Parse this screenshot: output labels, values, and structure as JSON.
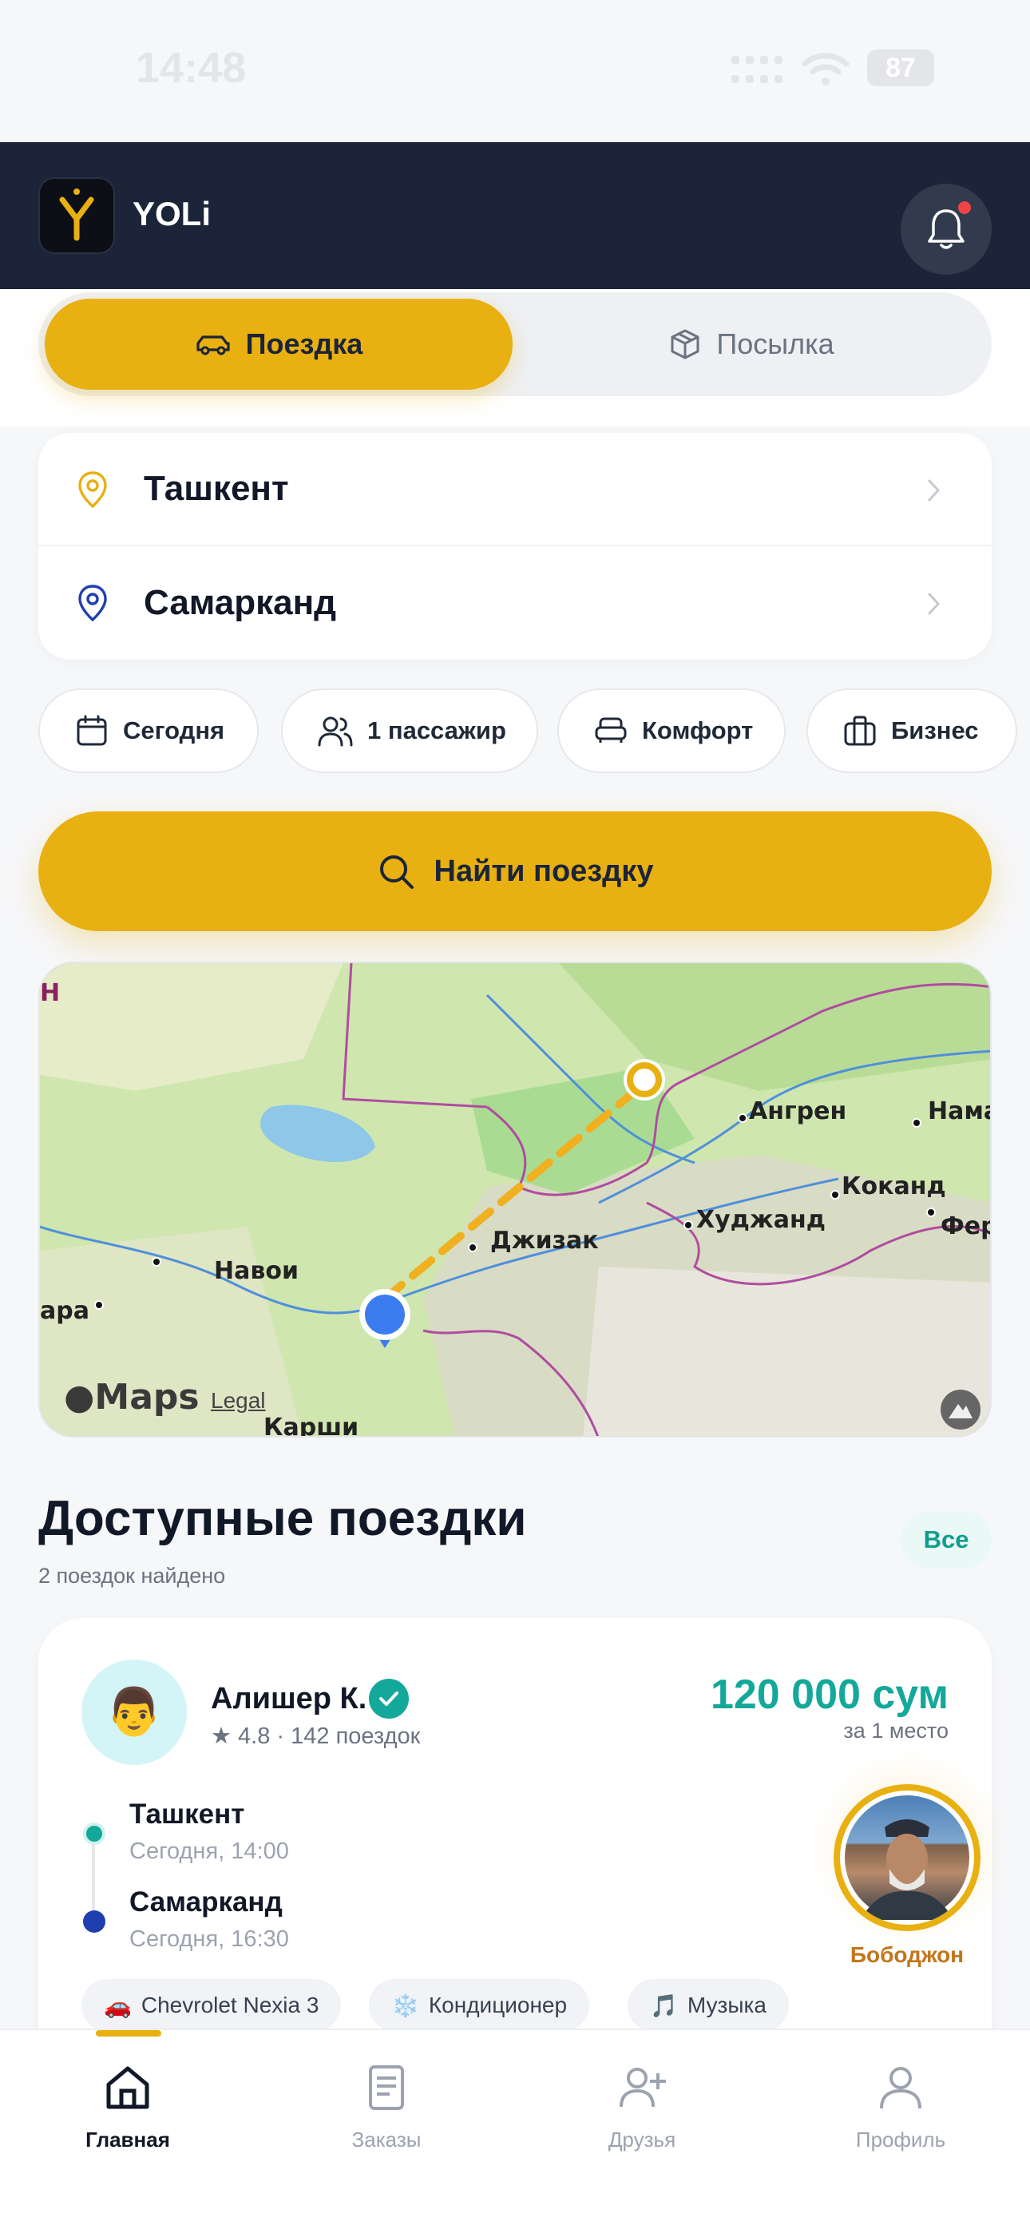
{
  "status_bar": {
    "time": "14:48",
    "battery": "87"
  },
  "header": {
    "brand": "YOLi",
    "logo_letter": "Y"
  },
  "segmented": {
    "ride_label": "Поездка",
    "parcel_label": "Посылка"
  },
  "route": {
    "from": "Ташкент",
    "to": "Самарканд"
  },
  "chips": [
    {
      "label": "Сегодня",
      "icon": "calendar-icon"
    },
    {
      "label": "1 пассажир",
      "icon": "users-icon"
    },
    {
      "label": "Комфорт",
      "icon": "sofa-icon"
    },
    {
      "label": "Бизнес",
      "icon": "briefcase-icon"
    }
  ],
  "search": {
    "button_label": "Найти поездку"
  },
  "map": {
    "cities": [
      "Ангрен",
      "Нама",
      "Коканд",
      "Фер",
      "Худжанд",
      "Джизак",
      "Навои",
      "ара",
      "Карши",
      "Н"
    ],
    "attribution": "Maps",
    "legal": "Legal"
  },
  "trips_section": {
    "title": "Доступные поездки",
    "subtitle": "2 поездок найдено",
    "all_label": "Все"
  },
  "trip": {
    "driver_name": "Алишер К.",
    "avatar_emoji": "👨",
    "rating": "★ 4.8 · 142 поездок",
    "price": "120 000 сум",
    "price_note": "за 1 место",
    "from_city": "Ташкент",
    "from_time": "Сегодня, 14:00",
    "to_city": "Самарканд",
    "to_time": "Сегодня, 16:30",
    "tags": [
      {
        "emoji": "🚗",
        "label": "Chevrolet Nexia 3"
      },
      {
        "emoji": "❄️",
        "label": "Кондиционер"
      },
      {
        "emoji": "🎵",
        "label": "Музыка"
      }
    ]
  },
  "guide": {
    "name": "Бободжон"
  },
  "tabbar": [
    {
      "label": "Главная",
      "icon": "home-icon",
      "active": true
    },
    {
      "label": "Заказы",
      "icon": "orders-icon",
      "active": false
    },
    {
      "label": "Друзья",
      "icon": "add-friend-icon",
      "active": false
    },
    {
      "label": "Профиль",
      "icon": "profile-icon",
      "active": false
    }
  ],
  "colors": {
    "accent": "#e8b010",
    "header": "#1b2438",
    "teal": "#14a89a",
    "blue": "#1f3fb0"
  }
}
